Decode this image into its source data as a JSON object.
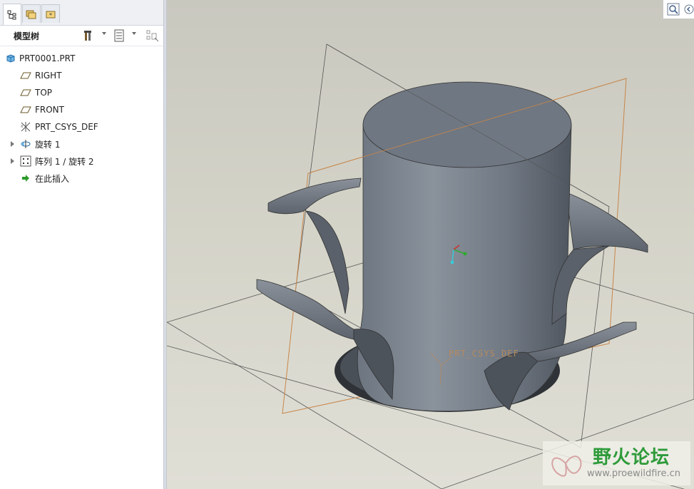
{
  "navigator": {
    "tabs": [
      {
        "name": "model-tree-tab",
        "icon": "tree-icon",
        "active": true
      },
      {
        "name": "folder-browser-tab",
        "icon": "folders-icon",
        "active": false
      },
      {
        "name": "favorites-tab",
        "icon": "star-folder-icon",
        "active": false
      }
    ],
    "title": "模型树",
    "toolbar_icons": [
      "settings-tools-icon",
      "tree-filter-icon",
      "show-columns-icon"
    ]
  },
  "model_tree": {
    "root": "PRT0001.PRT",
    "items": [
      {
        "label": "RIGHT",
        "icon": "datum-plane-icon",
        "expandable": false
      },
      {
        "label": "TOP",
        "icon": "datum-plane-icon",
        "expandable": false
      },
      {
        "label": "FRONT",
        "icon": "datum-plane-icon",
        "expandable": false
      },
      {
        "label": "PRT_CSYS_DEF",
        "icon": "csys-icon",
        "expandable": false
      },
      {
        "label": "旋转 1",
        "icon": "revolve-icon",
        "expandable": true
      },
      {
        "label": "阵列 1 / 旋转 2",
        "icon": "pattern-icon",
        "expandable": true
      },
      {
        "label": "在此插入",
        "icon": "insert-here-icon",
        "expandable": false
      }
    ]
  },
  "viewport": {
    "csys_label": "PRT_CSYS_DEF",
    "buttons": [
      "zoom-icon",
      "view-nav-icon"
    ]
  },
  "watermark": {
    "title": "野火论坛",
    "url": "www.proewildfire.cn"
  },
  "colors": {
    "model_fill": "#7f8690",
    "datum_orange": "#c7864a",
    "background": "#d4d3c8"
  }
}
